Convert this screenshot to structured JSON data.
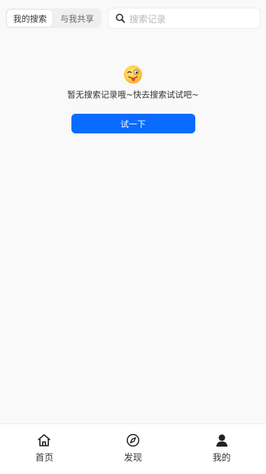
{
  "topbar": {
    "tabs": [
      {
        "label": "我的搜索",
        "active": true
      },
      {
        "label": "与我共享",
        "active": false
      }
    ],
    "search": {
      "placeholder": "搜索记录",
      "icon": "search-icon"
    }
  },
  "empty_state": {
    "emoji": "winking-face-with-tongue-icon",
    "message": "暂无搜索记录哦~快去搜索试试吧~",
    "button_label": "试一下"
  },
  "bottom_nav": {
    "items": [
      {
        "label": "首页",
        "icon": "home-icon"
      },
      {
        "label": "发现",
        "icon": "compass-icon"
      },
      {
        "label": "我的",
        "icon": "user-icon"
      }
    ]
  },
  "colors": {
    "accent": "#0a6bff",
    "background": "#f9f9f9"
  }
}
